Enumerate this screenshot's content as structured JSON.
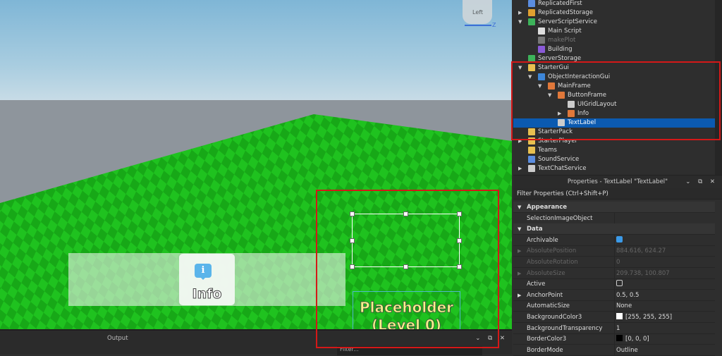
{
  "viewport": {
    "gizmo_label": "Left",
    "gizmo_axis": "Z",
    "info_button_label": "Info",
    "placeholder_text": "Placeholder (Level 0)"
  },
  "output": {
    "title": "Output",
    "filter_placeholder": "Filter...",
    "controls": "⌄ ⧉ ✕"
  },
  "explorer": {
    "items": [
      {
        "label": "ReplicatedFirst",
        "depth": 0,
        "arrow": "",
        "icon": "#5b8de0"
      },
      {
        "label": "ReplicatedStorage",
        "depth": 0,
        "arrow": "▶",
        "icon": "#e0a030"
      },
      {
        "label": "ServerScriptService",
        "depth": 0,
        "arrow": "▼",
        "icon": "#3db35a"
      },
      {
        "label": "Main Script",
        "depth": 1,
        "arrow": "",
        "icon": "#dddddd"
      },
      {
        "label": "makePlot",
        "depth": 1,
        "arrow": "",
        "icon": "#777777",
        "dim": true
      },
      {
        "label": "Building",
        "depth": 1,
        "arrow": "",
        "icon": "#8a5ad8"
      },
      {
        "label": "ServerStorage",
        "depth": 0,
        "arrow": "",
        "icon": "#3db35a"
      },
      {
        "label": "StarterGui",
        "depth": 0,
        "arrow": "▼",
        "icon": "#e8c050"
      },
      {
        "label": "ObjectInteractionGui",
        "depth": 1,
        "arrow": "▼",
        "icon": "#3d86d8"
      },
      {
        "label": "MainFrame",
        "depth": 2,
        "arrow": "▼",
        "icon": "#e0783a"
      },
      {
        "label": "ButtonFrame",
        "depth": 3,
        "arrow": "▼",
        "icon": "#e0783a"
      },
      {
        "label": "UIGridLayout",
        "depth": 4,
        "arrow": "",
        "icon": "#cccccc"
      },
      {
        "label": "Info",
        "depth": 4,
        "arrow": "▶",
        "icon": "#e0783a"
      },
      {
        "label": "TextLabel",
        "depth": 3,
        "arrow": "",
        "icon": "#cccccc",
        "selected": true
      },
      {
        "label": "StarterPack",
        "depth": 0,
        "arrow": "",
        "icon": "#e8c050"
      },
      {
        "label": "StarterPlayer",
        "depth": 0,
        "arrow": "▶",
        "icon": "#e8c050"
      },
      {
        "label": "Teams",
        "depth": 0,
        "arrow": "",
        "icon": "#e8c050"
      },
      {
        "label": "SoundService",
        "depth": 0,
        "arrow": "",
        "icon": "#5b8de0"
      },
      {
        "label": "TextChatService",
        "depth": 0,
        "arrow": "▶",
        "icon": "#cccccc"
      }
    ]
  },
  "properties": {
    "title": "Properties - TextLabel \"TextLabel\"",
    "controls": "⌄ ⧉ ✕",
    "filter": "Filter Properties (Ctrl+Shift+P)",
    "rows": [
      {
        "name": "Appearance",
        "category": true,
        "arrow": "▼"
      },
      {
        "name": "SelectionImageObject",
        "value": ""
      },
      {
        "name": "Data",
        "category": true,
        "arrow": "▼"
      },
      {
        "name": "Archivable",
        "checkbox": true,
        "checked": true
      },
      {
        "name": "AbsolutePosition",
        "value": "884.616, 624.27",
        "dim": true,
        "arrow": "▶"
      },
      {
        "name": "AbsoluteRotation",
        "value": "0",
        "dim": true
      },
      {
        "name": "AbsoluteSize",
        "value": "209.738, 100.807",
        "dim": true,
        "arrow": "▶"
      },
      {
        "name": "Active",
        "checkbox": true,
        "checked": false
      },
      {
        "name": "AnchorPoint",
        "value": "0.5, 0.5",
        "arrow": "▶"
      },
      {
        "name": "AutomaticSize",
        "value": "None"
      },
      {
        "name": "BackgroundColor3",
        "value": "[255, 255, 255]",
        "swatch": "#ffffff"
      },
      {
        "name": "BackgroundTransparency",
        "value": "1"
      },
      {
        "name": "BorderColor3",
        "value": "[0, 0, 0]",
        "swatch": "#000000"
      },
      {
        "name": "BorderMode",
        "value": "Outline"
      }
    ]
  }
}
